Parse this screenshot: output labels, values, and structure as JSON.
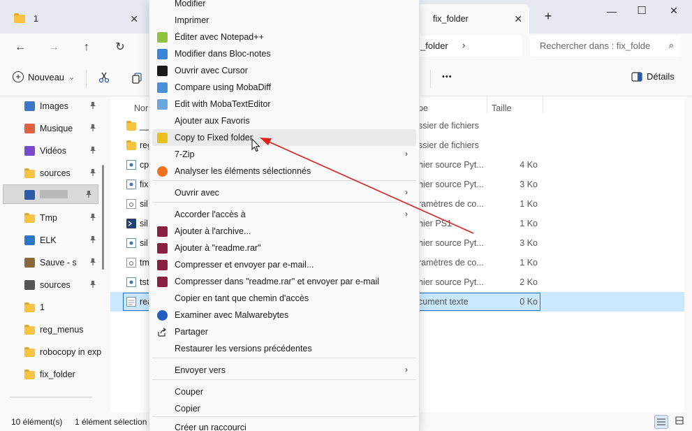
{
  "tabs": [
    {
      "label": "1",
      "active": false
    },
    {
      "label": "fix_folder",
      "active": true
    }
  ],
  "window": {
    "new_tab": "+",
    "minimize": "—",
    "maximize": "☐",
    "close": "✕"
  },
  "nav": {
    "back": "←",
    "forward": "→",
    "up": "↑",
    "refresh": "↻",
    "address_tail": "_folder",
    "address_chevron": "›",
    "search_placeholder": "Rechercher dans : fix_folde",
    "search_icon": "⌕"
  },
  "toolbar": {
    "new_label": "Nouveau",
    "new_chevron": "⌄",
    "more": "•••",
    "details_label": "Détails"
  },
  "sidebar": {
    "items": [
      {
        "label": "Images",
        "icon": "images-icon",
        "color": "#3b78c9",
        "pinned": true
      },
      {
        "label": "Musique",
        "icon": "music-icon",
        "color": "#e2603f",
        "pinned": true
      },
      {
        "label": "Vidéos",
        "icon": "videos-icon",
        "color": "#7a4bc9",
        "pinned": true
      },
      {
        "label": "sources",
        "icon": "folder-icon",
        "color": "#f5c242",
        "pinned": true
      },
      {
        "label": "",
        "icon": "drive-icon",
        "color": "#2b5aa8",
        "pinned": true,
        "selected": true
      },
      {
        "label": "Tmp",
        "icon": "folder-icon",
        "color": "#f5c242",
        "pinned": true
      },
      {
        "label": "ELK",
        "icon": "network-icon",
        "color": "#2c78c7",
        "pinned": true
      },
      {
        "label": "Sauve - s",
        "icon": "tools-icon",
        "color": "#8a6a3a",
        "pinned": true
      },
      {
        "label": "sources",
        "icon": "zip-icon",
        "color": "#555555",
        "pinned": true
      },
      {
        "label": "1",
        "icon": "folder-icon",
        "color": "#f5c242",
        "pinned": false
      },
      {
        "label": "reg_menus",
        "icon": "folder-icon",
        "color": "#f5c242",
        "pinned": false
      },
      {
        "label": "robocopy in exp",
        "icon": "folder-icon",
        "color": "#f5c242",
        "pinned": false
      },
      {
        "label": "fix_folder",
        "icon": "folder-icon",
        "color": "#f5c242",
        "pinned": false
      }
    ],
    "pin_glyph": "📌"
  },
  "columns": {
    "name": "Nor",
    "type": "pe",
    "size": "Taille"
  },
  "files": [
    {
      "name": "__",
      "type": "ssier de fichiers",
      "size": "",
      "icon": "folder-icon"
    },
    {
      "name": "reg",
      "type": "ssier de fichiers",
      "size": "",
      "icon": "folder-icon"
    },
    {
      "name": "cp",
      "type": "hier source Pyt...",
      "size": "4 Ko",
      "icon": "python-file-icon"
    },
    {
      "name": "fix",
      "type": "hier source Pyt...",
      "size": "3 Ko",
      "icon": "python-file-icon"
    },
    {
      "name": "sil",
      "type": "ramètres de co...",
      "size": "1 Ko",
      "icon": "config-file-icon"
    },
    {
      "name": "sil",
      "type": "hier PS1",
      "size": "1 Ko",
      "icon": "powershell-file-icon"
    },
    {
      "name": "sil",
      "type": "hier source Pyt...",
      "size": "3 Ko",
      "icon": "python-file-icon"
    },
    {
      "name": "tm",
      "type": "ramètres de co...",
      "size": "1 Ko",
      "icon": "config-file-icon"
    },
    {
      "name": "tst",
      "type": "hier source Pyt...",
      "size": "2 Ko",
      "icon": "python-file-icon"
    },
    {
      "name": "rea",
      "type": "cument texte",
      "size": "0 Ko",
      "icon": "text-file-icon",
      "selected": true
    }
  ],
  "status": {
    "count": "10 élément(s)",
    "selection": "1 élément sélection"
  },
  "context_menu": {
    "items": [
      {
        "label": "Modifier",
        "icon": "",
        "submenu": false
      },
      {
        "label": "Imprimer",
        "icon": "",
        "submenu": false
      },
      {
        "label": "Éditer avec Notepad++",
        "icon": "notepadpp-icon",
        "color": "#8fc33f",
        "submenu": false
      },
      {
        "label": "Modifier dans Bloc-notes",
        "icon": "notepad-icon",
        "color": "#3a86d6",
        "submenu": false
      },
      {
        "label": "Ouvrir avec Cursor",
        "icon": "cursor-app-icon",
        "color": "#1a1a1a",
        "submenu": false
      },
      {
        "label": "Compare using MobaDiff",
        "icon": "mobadiff-icon",
        "color": "#4a90d9",
        "submenu": false
      },
      {
        "label": "Edit with MobaTextEditor",
        "icon": "mobatexteditor-icon",
        "color": "#6aa6e0",
        "submenu": false
      },
      {
        "label": "Ajouter aux Favoris",
        "icon": "",
        "submenu": false
      },
      {
        "label": "Copy to Fixed folder",
        "icon": "copy-folder-icon",
        "color": "#e8c020",
        "submenu": false,
        "hover": true
      },
      {
        "label": "7-Zip",
        "icon": "",
        "submenu": true
      },
      {
        "label": "Analyser les éléments sélectionnés",
        "icon": "avast-icon",
        "color": "#f07020",
        "submenu": false
      },
      {
        "label": "Ouvrir avec",
        "icon": "",
        "submenu": true
      },
      {
        "label": "Accorder l'accès à",
        "icon": "",
        "submenu": true
      },
      {
        "label": "Ajouter à l'archive...",
        "icon": "winrar-icon",
        "color": "#8a2040",
        "submenu": false
      },
      {
        "label": "Ajouter à \"readme.rar\"",
        "icon": "winrar-icon",
        "color": "#8a2040",
        "submenu": false
      },
      {
        "label": "Compresser et envoyer par e-mail...",
        "icon": "winrar-icon",
        "color": "#8a2040",
        "submenu": false
      },
      {
        "label": "Compresser dans \"readme.rar\" et envoyer par e-mail",
        "icon": "winrar-icon",
        "color": "#8a2040",
        "submenu": false
      },
      {
        "label": "Copier en tant que chemin d'accès",
        "icon": "",
        "submenu": false
      },
      {
        "label": "Examiner avec Malwarebytes",
        "icon": "malwarebytes-icon",
        "color": "#1f5fbf",
        "submenu": false
      },
      {
        "label": "Partager",
        "icon": "share-icon",
        "color": "#333333",
        "submenu": false
      },
      {
        "label": "Restaurer les versions précédentes",
        "icon": "",
        "submenu": false
      },
      {
        "label": "Envoyer vers",
        "icon": "",
        "submenu": true
      },
      {
        "label": "Couper",
        "icon": "",
        "submenu": false
      },
      {
        "label": "Copier",
        "icon": "",
        "submenu": false
      },
      {
        "label": "Créer un raccourci",
        "icon": "",
        "submenu": false
      }
    ],
    "submenu_glyph": "›"
  },
  "annotation": {
    "color": "#e02020"
  }
}
